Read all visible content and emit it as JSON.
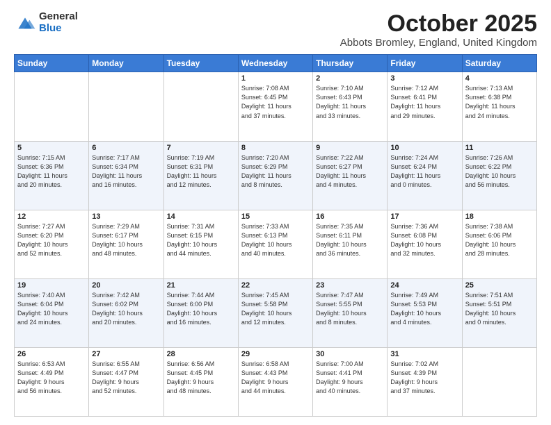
{
  "logo": {
    "general": "General",
    "blue": "Blue"
  },
  "header": {
    "month": "October 2025",
    "location": "Abbots Bromley, England, United Kingdom"
  },
  "weekdays": [
    "Sunday",
    "Monday",
    "Tuesday",
    "Wednesday",
    "Thursday",
    "Friday",
    "Saturday"
  ],
  "weeks": [
    [
      {
        "day": "",
        "info": ""
      },
      {
        "day": "",
        "info": ""
      },
      {
        "day": "",
        "info": ""
      },
      {
        "day": "1",
        "info": "Sunrise: 7:08 AM\nSunset: 6:45 PM\nDaylight: 11 hours\nand 37 minutes."
      },
      {
        "day": "2",
        "info": "Sunrise: 7:10 AM\nSunset: 6:43 PM\nDaylight: 11 hours\nand 33 minutes."
      },
      {
        "day": "3",
        "info": "Sunrise: 7:12 AM\nSunset: 6:41 PM\nDaylight: 11 hours\nand 29 minutes."
      },
      {
        "day": "4",
        "info": "Sunrise: 7:13 AM\nSunset: 6:38 PM\nDaylight: 11 hours\nand 24 minutes."
      }
    ],
    [
      {
        "day": "5",
        "info": "Sunrise: 7:15 AM\nSunset: 6:36 PM\nDaylight: 11 hours\nand 20 minutes."
      },
      {
        "day": "6",
        "info": "Sunrise: 7:17 AM\nSunset: 6:34 PM\nDaylight: 11 hours\nand 16 minutes."
      },
      {
        "day": "7",
        "info": "Sunrise: 7:19 AM\nSunset: 6:31 PM\nDaylight: 11 hours\nand 12 minutes."
      },
      {
        "day": "8",
        "info": "Sunrise: 7:20 AM\nSunset: 6:29 PM\nDaylight: 11 hours\nand 8 minutes."
      },
      {
        "day": "9",
        "info": "Sunrise: 7:22 AM\nSunset: 6:27 PM\nDaylight: 11 hours\nand 4 minutes."
      },
      {
        "day": "10",
        "info": "Sunrise: 7:24 AM\nSunset: 6:24 PM\nDaylight: 11 hours\nand 0 minutes."
      },
      {
        "day": "11",
        "info": "Sunrise: 7:26 AM\nSunset: 6:22 PM\nDaylight: 10 hours\nand 56 minutes."
      }
    ],
    [
      {
        "day": "12",
        "info": "Sunrise: 7:27 AM\nSunset: 6:20 PM\nDaylight: 10 hours\nand 52 minutes."
      },
      {
        "day": "13",
        "info": "Sunrise: 7:29 AM\nSunset: 6:17 PM\nDaylight: 10 hours\nand 48 minutes."
      },
      {
        "day": "14",
        "info": "Sunrise: 7:31 AM\nSunset: 6:15 PM\nDaylight: 10 hours\nand 44 minutes."
      },
      {
        "day": "15",
        "info": "Sunrise: 7:33 AM\nSunset: 6:13 PM\nDaylight: 10 hours\nand 40 minutes."
      },
      {
        "day": "16",
        "info": "Sunrise: 7:35 AM\nSunset: 6:11 PM\nDaylight: 10 hours\nand 36 minutes."
      },
      {
        "day": "17",
        "info": "Sunrise: 7:36 AM\nSunset: 6:08 PM\nDaylight: 10 hours\nand 32 minutes."
      },
      {
        "day": "18",
        "info": "Sunrise: 7:38 AM\nSunset: 6:06 PM\nDaylight: 10 hours\nand 28 minutes."
      }
    ],
    [
      {
        "day": "19",
        "info": "Sunrise: 7:40 AM\nSunset: 6:04 PM\nDaylight: 10 hours\nand 24 minutes."
      },
      {
        "day": "20",
        "info": "Sunrise: 7:42 AM\nSunset: 6:02 PM\nDaylight: 10 hours\nand 20 minutes."
      },
      {
        "day": "21",
        "info": "Sunrise: 7:44 AM\nSunset: 6:00 PM\nDaylight: 10 hours\nand 16 minutes."
      },
      {
        "day": "22",
        "info": "Sunrise: 7:45 AM\nSunset: 5:58 PM\nDaylight: 10 hours\nand 12 minutes."
      },
      {
        "day": "23",
        "info": "Sunrise: 7:47 AM\nSunset: 5:55 PM\nDaylight: 10 hours\nand 8 minutes."
      },
      {
        "day": "24",
        "info": "Sunrise: 7:49 AM\nSunset: 5:53 PM\nDaylight: 10 hours\nand 4 minutes."
      },
      {
        "day": "25",
        "info": "Sunrise: 7:51 AM\nSunset: 5:51 PM\nDaylight: 10 hours\nand 0 minutes."
      }
    ],
    [
      {
        "day": "26",
        "info": "Sunrise: 6:53 AM\nSunset: 4:49 PM\nDaylight: 9 hours\nand 56 minutes."
      },
      {
        "day": "27",
        "info": "Sunrise: 6:55 AM\nSunset: 4:47 PM\nDaylight: 9 hours\nand 52 minutes."
      },
      {
        "day": "28",
        "info": "Sunrise: 6:56 AM\nSunset: 4:45 PM\nDaylight: 9 hours\nand 48 minutes."
      },
      {
        "day": "29",
        "info": "Sunrise: 6:58 AM\nSunset: 4:43 PM\nDaylight: 9 hours\nand 44 minutes."
      },
      {
        "day": "30",
        "info": "Sunrise: 7:00 AM\nSunset: 4:41 PM\nDaylight: 9 hours\nand 40 minutes."
      },
      {
        "day": "31",
        "info": "Sunrise: 7:02 AM\nSunset: 4:39 PM\nDaylight: 9 hours\nand 37 minutes."
      },
      {
        "day": "",
        "info": ""
      }
    ]
  ]
}
